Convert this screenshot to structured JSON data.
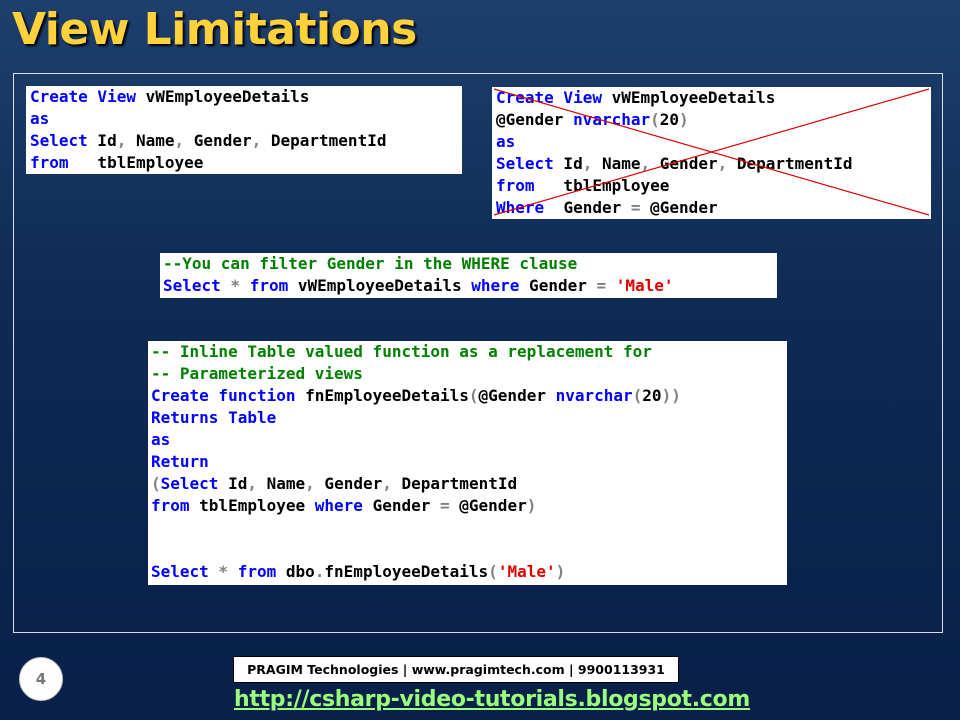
{
  "slide": {
    "title": "View Limitations",
    "page_number": "4",
    "footer_text": "PRAGIM Technologies | www.pragimtech.com | 9900113931",
    "footer_url": "http://csharp-video-tutorials.blogspot.com"
  },
  "box1": {
    "l1_kw": "Create View",
    "l1_rest": " vWEmployeeDetails",
    "l2_kw": "as",
    "l3_kw": "Select",
    "l3_a": " Id",
    "l3_b": " Name",
    "l3_c": " Gender",
    "l3_d": " DepartmentId",
    "l4_kw": "from",
    "l4_rest": "   tblEmployee"
  },
  "box2": {
    "l1_kw": "Create View",
    "l1_rest": " vWEmployeeDetails",
    "l2_a": "@Gender ",
    "l2_kw": "nvarchar",
    "l2_num": "20",
    "l3_kw": "as",
    "l4_kw": "Select",
    "l4_a": " Id",
    "l4_b": " Name",
    "l4_c": " Gender",
    "l4_d": " DepartmentId",
    "l5_kw": "from",
    "l5_rest": "   tblEmployee",
    "l6_kw": "Where",
    "l6_a": "  Gender ",
    "l6_b": " @Gender"
  },
  "box3": {
    "comment": "--You can filter Gender in the WHERE clause",
    "kw_select": "Select",
    "star": " *",
    "kw_from": " from",
    "view": " vWEmployeeDetails",
    "kw_where": " where",
    "col": " Gender ",
    "str": " 'Male'"
  },
  "box4": {
    "comment1": "-- Inline Table valued function as a replacement for",
    "comment2": "-- Parameterized views",
    "l3_kw": "Create function",
    "l3_name": " fnEmployeeDetails",
    "l3_param": "@Gender ",
    "l3_type": "nvarchar",
    "l3_num": "20",
    "l4_kw": "Returns Table",
    "l5_kw": "as",
    "l6_kw": "Return",
    "l7_kw": "Select",
    "l7_a": " Id",
    "l7_b": " Name",
    "l7_c": " Gender",
    "l7_d": " DepartmentId",
    "l8_from": "from",
    "l8_tbl": " tblEmployee ",
    "l8_where": "where",
    "l8_col": " Gender ",
    "l8_param": " @Gender",
    "l9_select": "Select",
    "l9_star": " *",
    "l9_from": " from",
    "l9_fn": " dbo",
    "l9_fn2": "fnEmployeeDetails",
    "l9_str": "'Male'"
  },
  "colors": {
    "title": "#ffd23c",
    "keyword": "#0000ff",
    "comment": "#008000",
    "string": "#e00000",
    "strike": "#e00000",
    "url": "#9aff7a"
  }
}
